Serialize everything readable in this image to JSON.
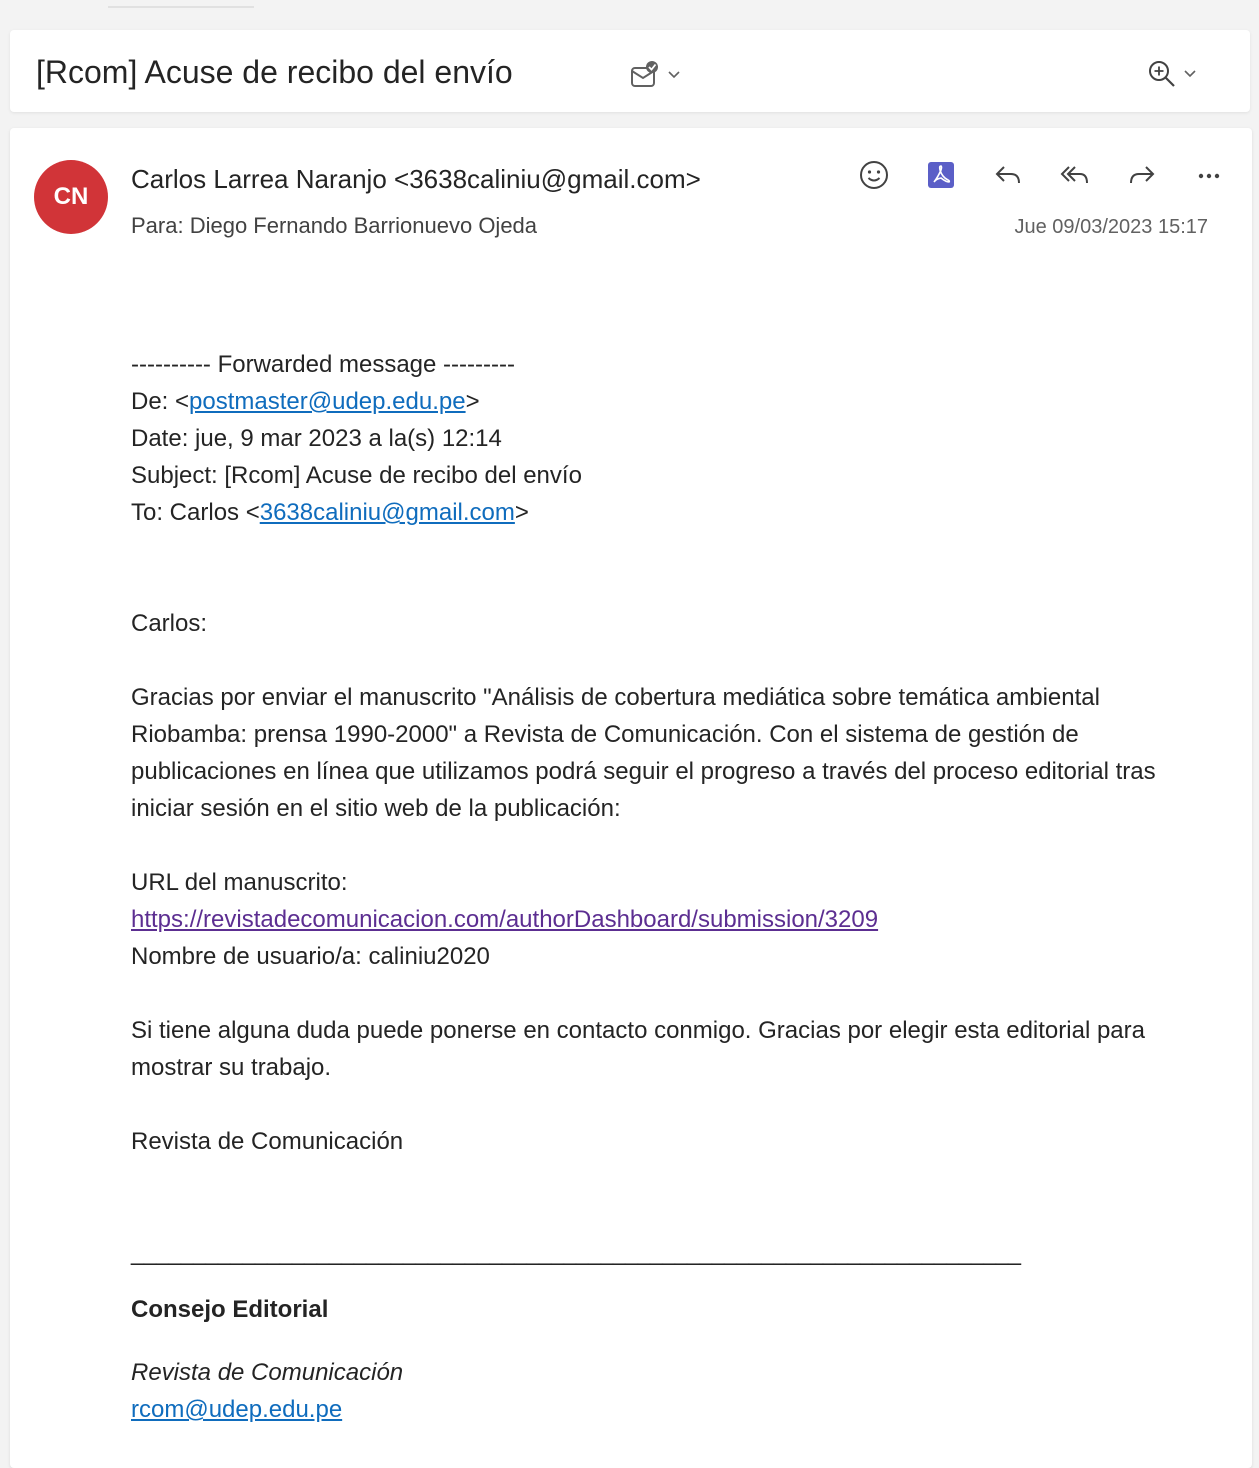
{
  "subject": {
    "title": "[Rcom] Acuse de recibo del envío",
    "icons": [
      "mark-read-icon",
      "chevron-down-icon"
    ],
    "zoom_icons": [
      "zoom-in-icon",
      "chevron-down-icon"
    ]
  },
  "message": {
    "avatar_initials": "CN",
    "avatar_color": "#d13438",
    "sender": "Carlos Larrea Naranjo <3638caliniu@gmail.com>",
    "to": "Para:  Diego Fernando Barrionuevo Ojeda",
    "date": "Jue 09/03/2023 15:17",
    "actions": [
      "emoji-smile-icon",
      "pdf-icon",
      "reply-icon",
      "reply-all-icon",
      "forward-icon",
      "more-icon"
    ],
    "accent_color": "#5b5fc7"
  },
  "body": {
    "forward_header": "---------- Forwarded message ---------",
    "from_prefix": "De: <",
    "from_email": "postmaster@udep.edu.pe",
    "from_suffix": ">",
    "date_line": "Date: jue, 9 mar 2023 a la(s) 12:14",
    "subject_line": "Subject: [Rcom] Acuse de recibo del envío",
    "to_prefix": "To: Carlos <",
    "to_email": "3638caliniu@gmail.com",
    "to_suffix": ">",
    "greeting": "Carlos:",
    "paragraph1": "Gracias por enviar el manuscrito \"Análisis de cobertura mediática sobre temática ambiental Riobamba: prensa 1990-2000\" a Revista de Comunicación. Con el sistema de gestión de publicaciones en línea que utilizamos podrá seguir el progreso a través del proceso editorial tras iniciar sesión en el sitio web de la publicación:",
    "url_label": "URL del manuscrito:",
    "url": "https://revistadecomunicacion.com/authorDashboard/submission/3209",
    "username": "Nombre de usuario/a: caliniu2020",
    "paragraph2": "Si tiene alguna duda puede ponerse en contacto conmigo. Gracias por elegir esta editorial para mostrar su trabajo.",
    "signoff": "Revista de Comunicación",
    "rule": "________________________________________________________________________",
    "signature_title": "Consejo Editorial",
    "signature_org": "Revista de Comunicación",
    "signature_email": "rcom@udep.edu.pe"
  }
}
